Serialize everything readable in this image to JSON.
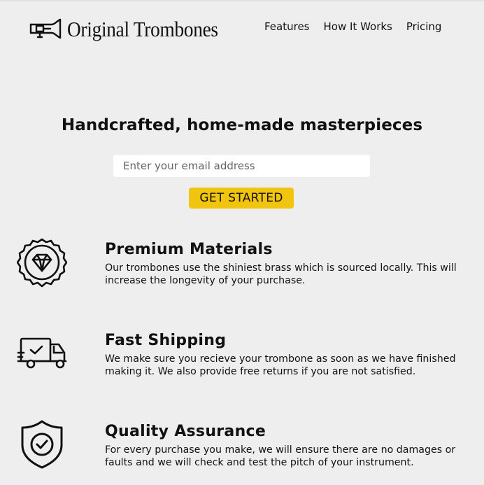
{
  "header": {
    "logo_text": "Original Trombones",
    "logo_icon": "trombone-icon",
    "nav": [
      {
        "label": "Features"
      },
      {
        "label": "How It Works"
      },
      {
        "label": "Pricing"
      }
    ]
  },
  "hero": {
    "title": "Handcrafted, home-made masterpieces",
    "email_placeholder": "Enter your email address",
    "cta_label": "GET STARTED"
  },
  "features": [
    {
      "icon": "diamond-badge-icon",
      "title": "Premium Materials",
      "description": "Our trombones use the shiniest brass which is sourced locally. This will increase the longevity of your purchase."
    },
    {
      "icon": "delivery-truck-icon",
      "title": "Fast Shipping",
      "description": "We make sure you recieve your trombone as soon as we have finished making it. We also provide free returns if you are not satisfied."
    },
    {
      "icon": "shield-check-icon",
      "title": "Quality Assurance",
      "description": "For every purchase you make, we will ensure there are no damages or faults and we will check and test the pitch of your instrument."
    }
  ],
  "colors": {
    "background": "#eeeeee",
    "accent": "#f1c40f",
    "text": "#111111"
  }
}
